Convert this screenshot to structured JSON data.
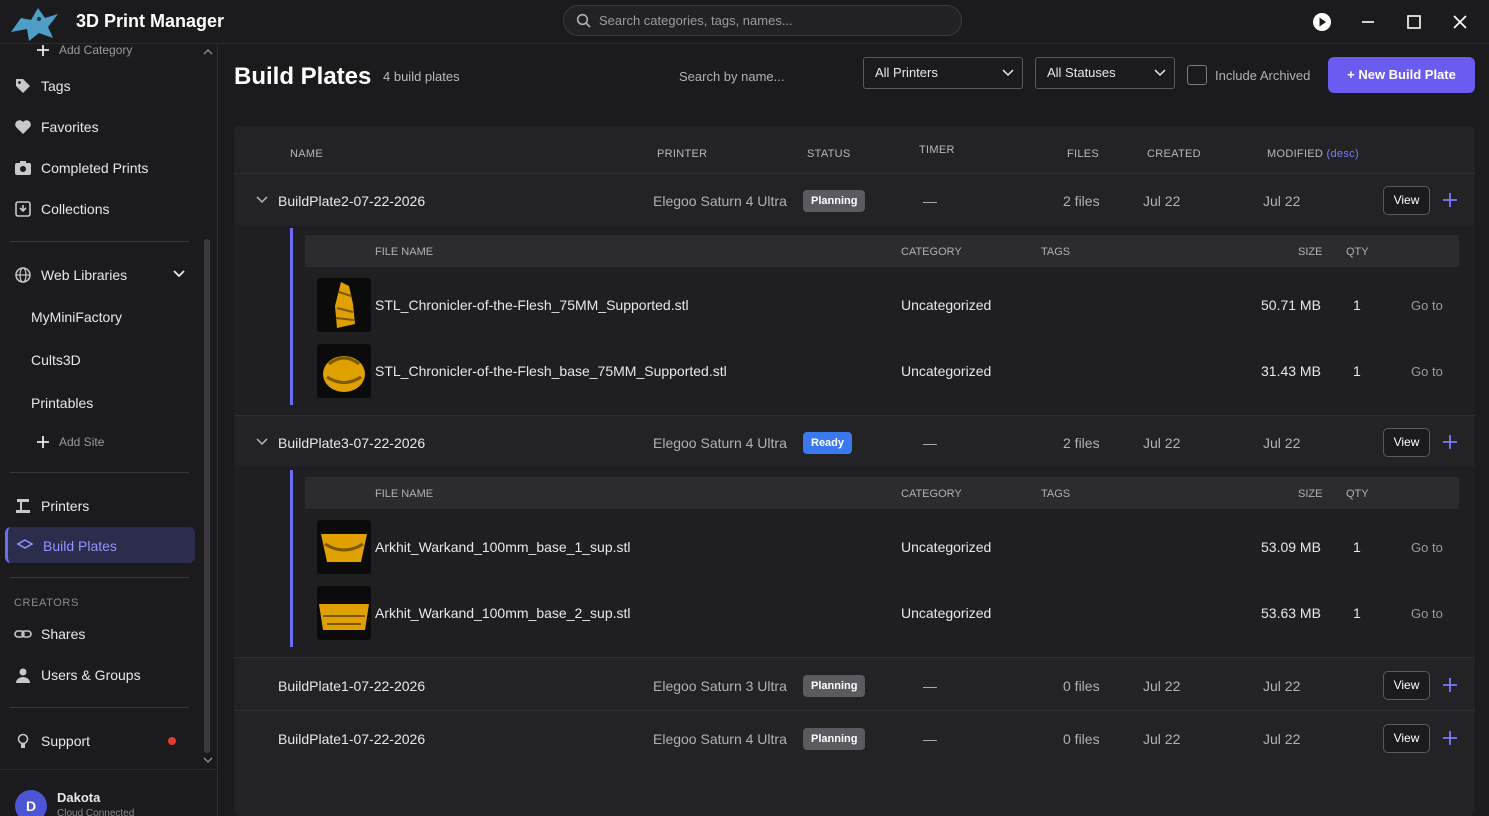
{
  "app": {
    "title": "3D Print Manager",
    "search_placeholder": "Search categories, tags, names..."
  },
  "sidebar": {
    "add_category": "Add Category",
    "items": [
      {
        "label": "Tags",
        "icon": "tag-icon"
      },
      {
        "label": "Favorites",
        "icon": "heart-icon"
      },
      {
        "label": "Completed Prints",
        "icon": "camera-icon"
      },
      {
        "label": "Collections",
        "icon": "collection-icon"
      }
    ],
    "web_libraries": {
      "label": "Web Libraries",
      "sites": [
        "MyMiniFactory",
        "Cults3D",
        "Printables"
      ],
      "add_site": "Add Site"
    },
    "printers": "Printers",
    "build_plates": "Build Plates",
    "creators_label": "CREATORS",
    "shares": "Shares",
    "users_groups": "Users & Groups",
    "support": "Support",
    "user": {
      "initial": "D",
      "name": "Dakota",
      "status": "Cloud Connected"
    }
  },
  "page": {
    "title": "Build Plates",
    "count": "4 build plates",
    "search_placeholder": "Search by name...",
    "printer_filter": "All Printers",
    "status_filter": "All Statuses",
    "include_archived": "Include Archived",
    "new_button": "+ New Build Plate"
  },
  "table": {
    "headers": {
      "name": "NAME",
      "printer": "PRINTER",
      "status": "STATUS",
      "timer": "TIMER",
      "files": "FILES",
      "created": "CREATED",
      "modified": "MODIFIED",
      "sort": "(desc)"
    },
    "sub_headers": {
      "file_name": "FILE NAME",
      "category": "CATEGORY",
      "tags": "TAGS",
      "size": "SIZE",
      "qty": "QTY"
    },
    "rows": [
      {
        "name": "BuildPlate2-07-22-2026",
        "printer": "Elegoo Saturn 4 Ultra",
        "status": "Planning",
        "timer": "—",
        "files": "2 files",
        "created": "Jul 22",
        "modified": "Jul 22",
        "view": "View",
        "files_list": [
          {
            "name": "STL_Chronicler-of-the-Flesh_75MM_Supported.stl",
            "category": "Uncategorized",
            "size": "50.71 MB",
            "qty": "1",
            "goto": "Go to"
          },
          {
            "name": "STL_Chronicler-of-the-Flesh_base_75MM_Supported.stl",
            "category": "Uncategorized",
            "size": "31.43 MB",
            "qty": "1",
            "goto": "Go to"
          }
        ]
      },
      {
        "name": "BuildPlate3-07-22-2026",
        "printer": "Elegoo Saturn 4 Ultra",
        "status": "Ready",
        "timer": "—",
        "files": "2 files",
        "created": "Jul 22",
        "modified": "Jul 22",
        "view": "View",
        "files_list": [
          {
            "name": "Arkhit_Warkand_100mm_base_1_sup.stl",
            "category": "Uncategorized",
            "size": "53.09 MB",
            "qty": "1",
            "goto": "Go to"
          },
          {
            "name": "Arkhit_Warkand_100mm_base_2_sup.stl",
            "category": "Uncategorized",
            "size": "53.63 MB",
            "qty": "1",
            "goto": "Go to"
          }
        ]
      },
      {
        "name": "BuildPlate1-07-22-2026",
        "printer": "Elegoo Saturn 3 Ultra",
        "status": "Planning",
        "timer": "—",
        "files": "0 files",
        "created": "Jul 22",
        "modified": "Jul 22",
        "view": "View"
      },
      {
        "name": "BuildPlate1-07-22-2026",
        "printer": "Elegoo Saturn 4 Ultra",
        "status": "Planning",
        "timer": "—",
        "files": "0 files",
        "created": "Jul 22",
        "modified": "Jul 22",
        "view": "View"
      }
    ]
  },
  "colors": {
    "accent": "#6a5cf0",
    "ready": "#3a78f0",
    "planning": "#5a5a60",
    "thumbnail": "#e0a000"
  }
}
